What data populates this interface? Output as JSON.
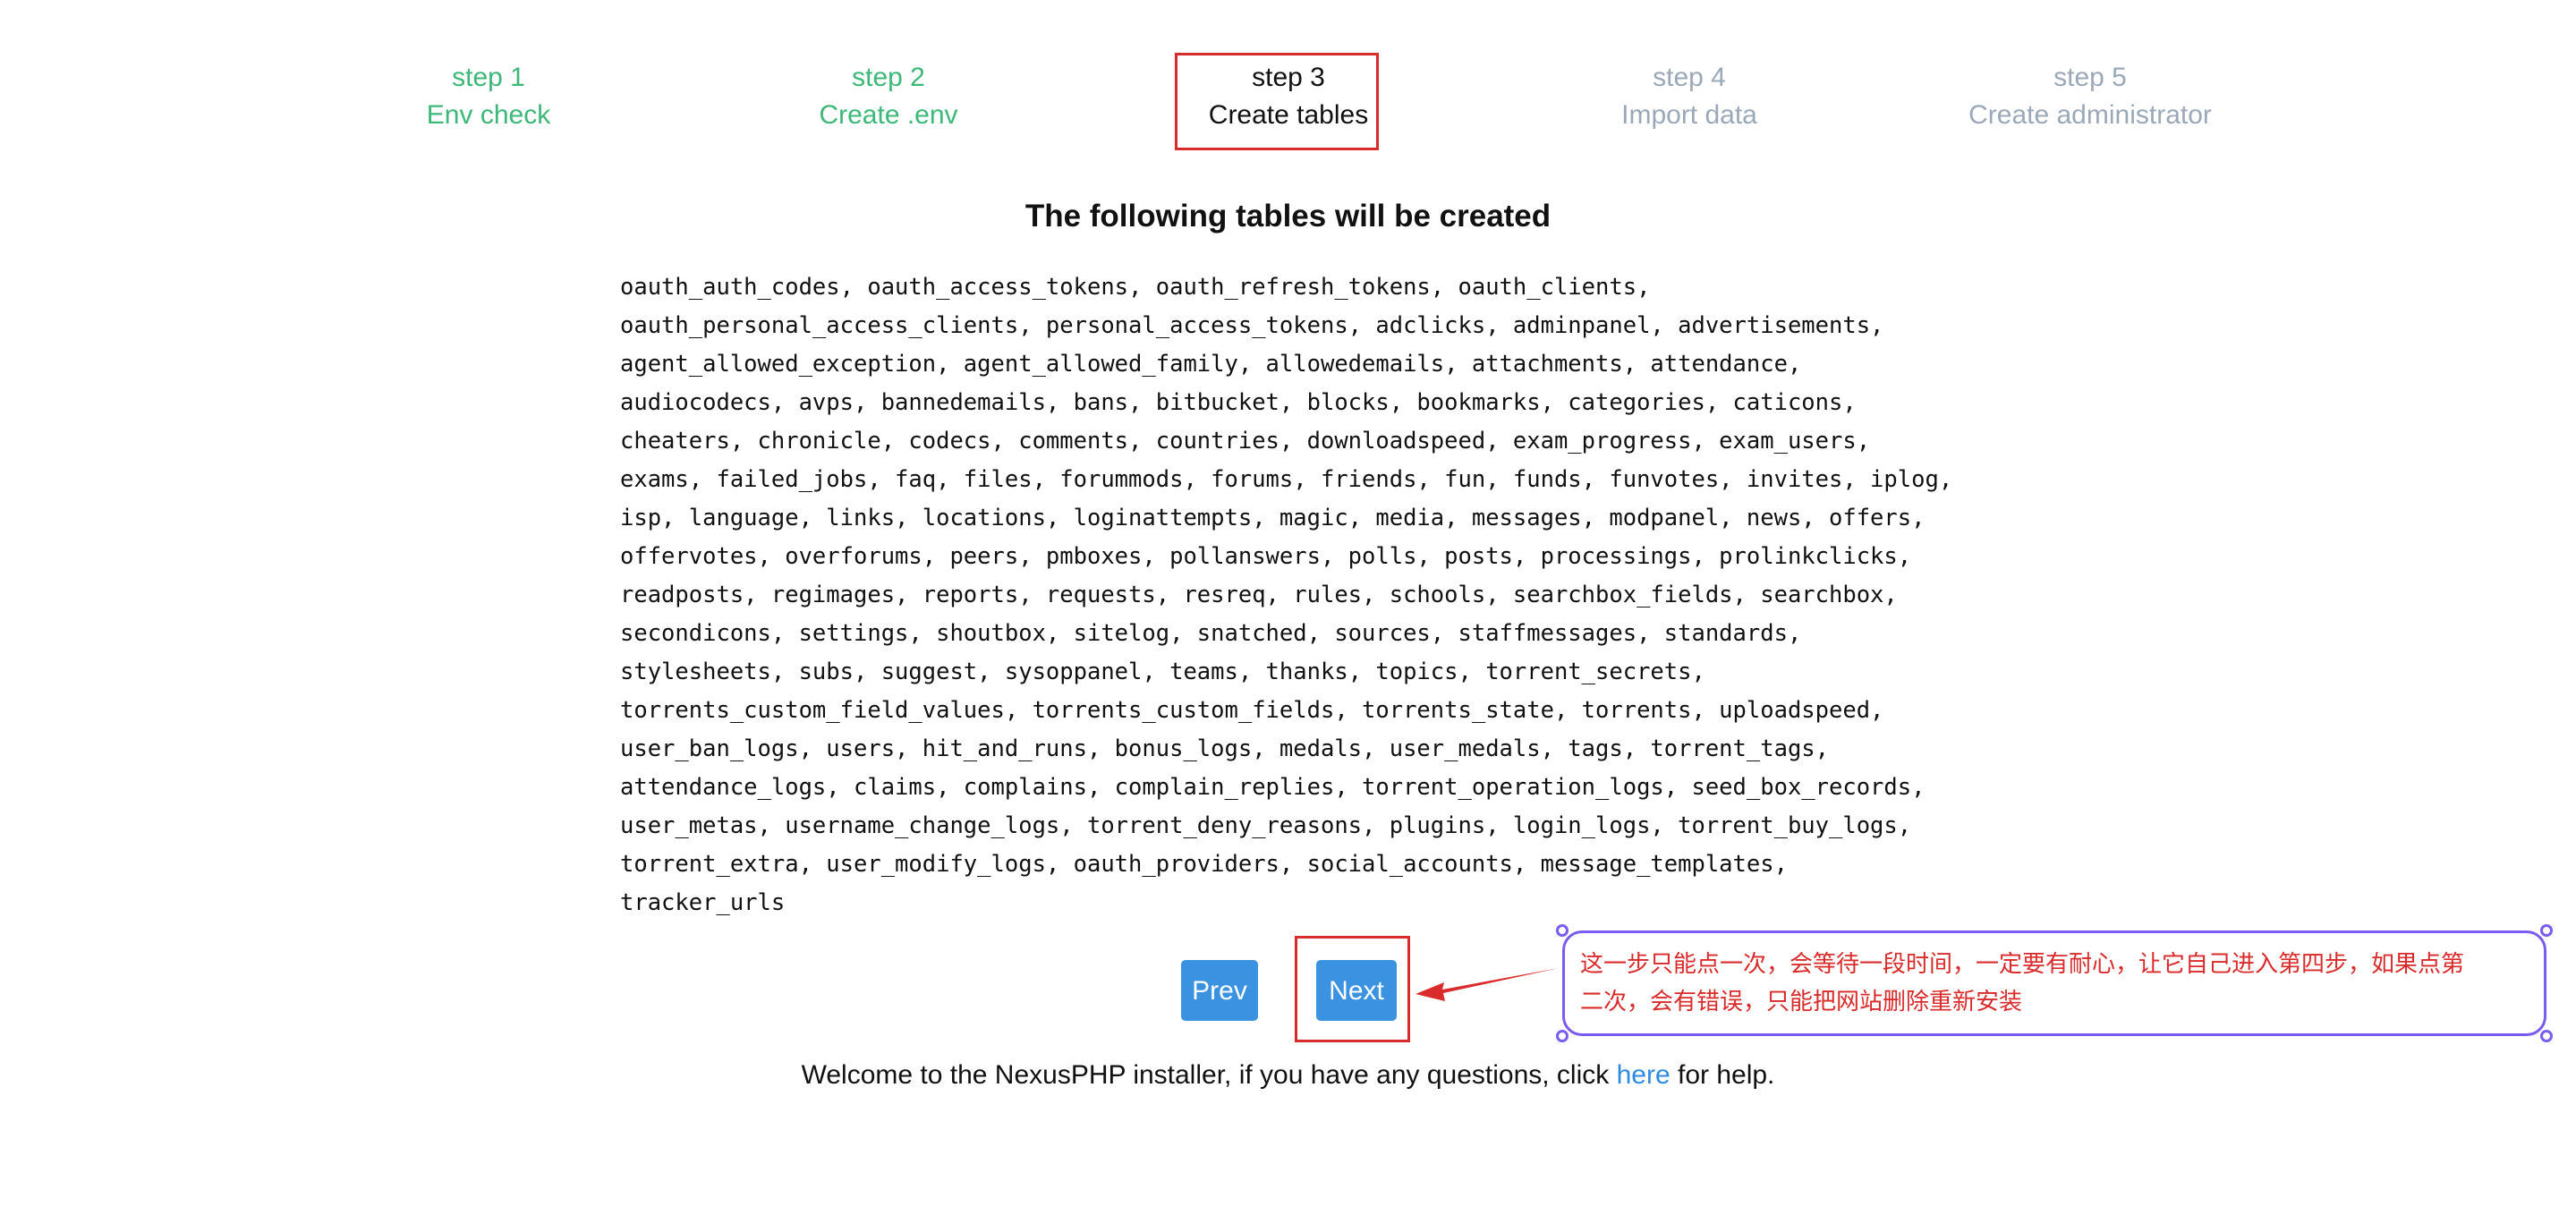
{
  "colors": {
    "step_done": "#3cb878",
    "step_todo": "#9aa8b8",
    "step_current": "#111111",
    "button": "#3b92e0",
    "highlight_box": "#d92b2b",
    "annotation_border": "#7b5cf0",
    "annotation_text": "#d92b2b",
    "link": "#2f8be0"
  },
  "steps": [
    {
      "step": "step 1",
      "label": "Env check",
      "status": "done"
    },
    {
      "step": "step 2",
      "label": "Create .env",
      "status": "done"
    },
    {
      "step": "step 3",
      "label": "Create tables",
      "status": "current"
    },
    {
      "step": "step 4",
      "label": "Import data",
      "status": "todo"
    },
    {
      "step": "step 5",
      "label": "Create administrator",
      "status": "todo"
    }
  ],
  "heading": "The following tables will be created",
  "tables_lines": [
    "oauth_auth_codes, oauth_access_tokens, oauth_refresh_tokens, oauth_clients,",
    "oauth_personal_access_clients, personal_access_tokens, adclicks, adminpanel, advertisements,",
    "agent_allowed_exception, agent_allowed_family, allowedemails, attachments, attendance,",
    "audiocodecs, avps, bannedemails, bans, bitbucket, blocks, bookmarks, categories, caticons,",
    "cheaters, chronicle, codecs, comments, countries, downloadspeed, exam_progress, exam_users,",
    "exams, failed_jobs, faq, files, forummods, forums, friends, fun, funds, funvotes, invites, iplog,",
    "isp, language, links, locations, loginattempts, magic, media, messages, modpanel, news, offers,",
    "offervotes, overforums, peers, pmboxes, pollanswers, polls, posts, processings, prolinkclicks,",
    "readposts, regimages, reports, requests, resreq, rules, schools, searchbox_fields, searchbox,",
    "secondicons, settings, shoutbox, sitelog, snatched, sources, staffmessages, standards,",
    "stylesheets, subs, suggest, sysoppanel, teams, thanks, topics, torrent_secrets,",
    "torrents_custom_field_values, torrents_custom_fields, torrents_state, torrents, uploadspeed,",
    "user_ban_logs, users, hit_and_runs, bonus_logs, medals, user_medals, tags, torrent_tags,",
    "attendance_logs, claims, complains, complain_replies, torrent_operation_logs, seed_box_records,",
    "user_metas, username_change_logs, torrent_deny_reasons, plugins, login_logs, torrent_buy_logs,",
    "torrent_extra, user_modify_logs, oauth_providers, social_accounts, message_templates,",
    "tracker_urls"
  ],
  "buttons": {
    "prev": "Prev",
    "next": "Next"
  },
  "annotation": {
    "line1": "这一步只能点一次，会等待一段时间，一定要有耐心，让它自己进入第四步，如果点第",
    "line2": "二次，会有错误，只能把网站删除重新安装"
  },
  "footer": {
    "before": "Welcome to the NexusPHP installer, if you have any questions, click ",
    "link": "here",
    "after": " for help."
  }
}
